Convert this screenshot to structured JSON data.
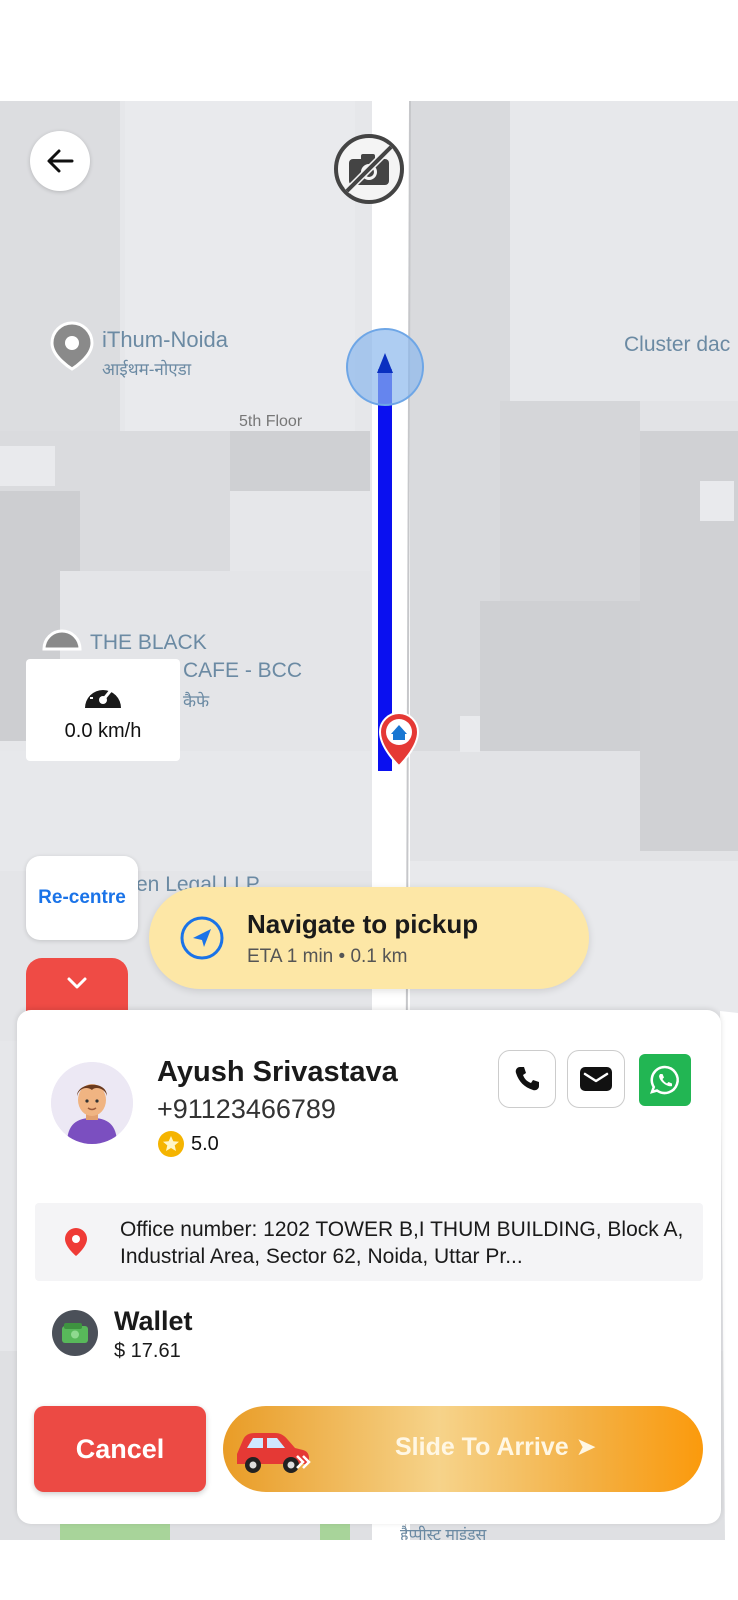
{
  "map": {
    "labels": {
      "ithum": "iThum-Noida",
      "ithum_hindi": "आईथम-नोएडा",
      "cluster": "Cluster dac",
      "floor": "5th Floor",
      "black_line1": "THE BLACK",
      "black_line2": "CAFE - BCC",
      "black_hindi": "कैफे",
      "legal": "en Legal LLP",
      "hapst": "हैप्पीस्ट माइंड्स"
    },
    "route_color": "#0a10f0",
    "pickup_pin_color": "#e53935"
  },
  "back_button": {
    "icon": "arrow-left-icon"
  },
  "camera_button": {
    "icon": "camera-off-icon"
  },
  "speed": {
    "icon": "speedometer-icon",
    "value": "0.0 km/h"
  },
  "recentre": {
    "label": "Re-centre"
  },
  "collapse": {
    "icon": "chevron-down-icon"
  },
  "navigation": {
    "icon": "navigation-arrow-icon",
    "title": "Navigate to pickup",
    "subtitle": "ETA 1 min • 0.1 km"
  },
  "rider": {
    "name": "Ayush Srivastava",
    "phone": "+91123466789",
    "rating": "5.0"
  },
  "contact": {
    "call_icon": "phone-icon",
    "message_icon": "message-icon",
    "whatsapp_icon": "whatsapp-icon",
    "whatsapp_color": "#22b653"
  },
  "pickup": {
    "address": "Office number: 1202 TOWER B,I THUM BUILDING, Block A, Industrial Area, Sector 62, Noida, Uttar Pr..."
  },
  "payment": {
    "method": "Wallet",
    "amount": "$ 17.61"
  },
  "actions": {
    "cancel_label": "Cancel",
    "slide_label": "Slide To Arrive ➤",
    "cancel_color": "#ec4a44",
    "slide_color": "#fb9a0c"
  }
}
